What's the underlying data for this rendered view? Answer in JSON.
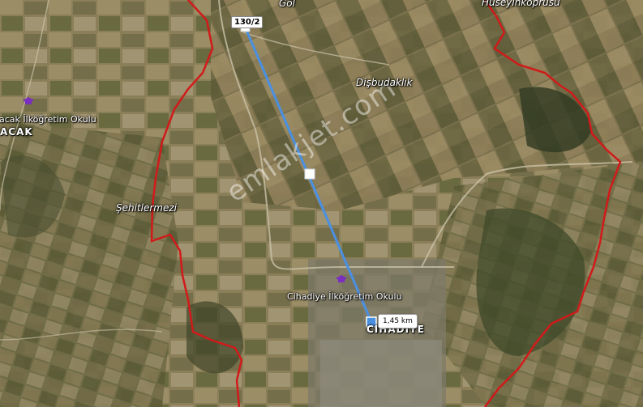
{
  "map": {
    "place_labels": {
      "gol": "Göl",
      "huseyinkoprusu": "Hüseyinköprüsü",
      "disbudaklik": "Dişbudaklık",
      "sehitlermezi": "Şehitlermezi",
      "cacak_school": "acak İlköğretim Okulu",
      "acak_town": "ACAK",
      "cihadiye_school": "Cihadiye İlköğretim Okulu",
      "cihadiye_town": "CIHADIYE"
    },
    "parcel_marker": {
      "label": "130/2"
    },
    "measurement": {
      "distance": "1,45 km"
    },
    "watermark": "emlakjet.com",
    "colors": {
      "boundary": "#d11a1a",
      "measure_line": "#4a90e2",
      "school_icon": "#7b2fbf"
    },
    "icons": {
      "school": "school-icon",
      "endpoint": "measure-endpoint-icon",
      "midpoint": "measure-midpoint-handle"
    }
  }
}
